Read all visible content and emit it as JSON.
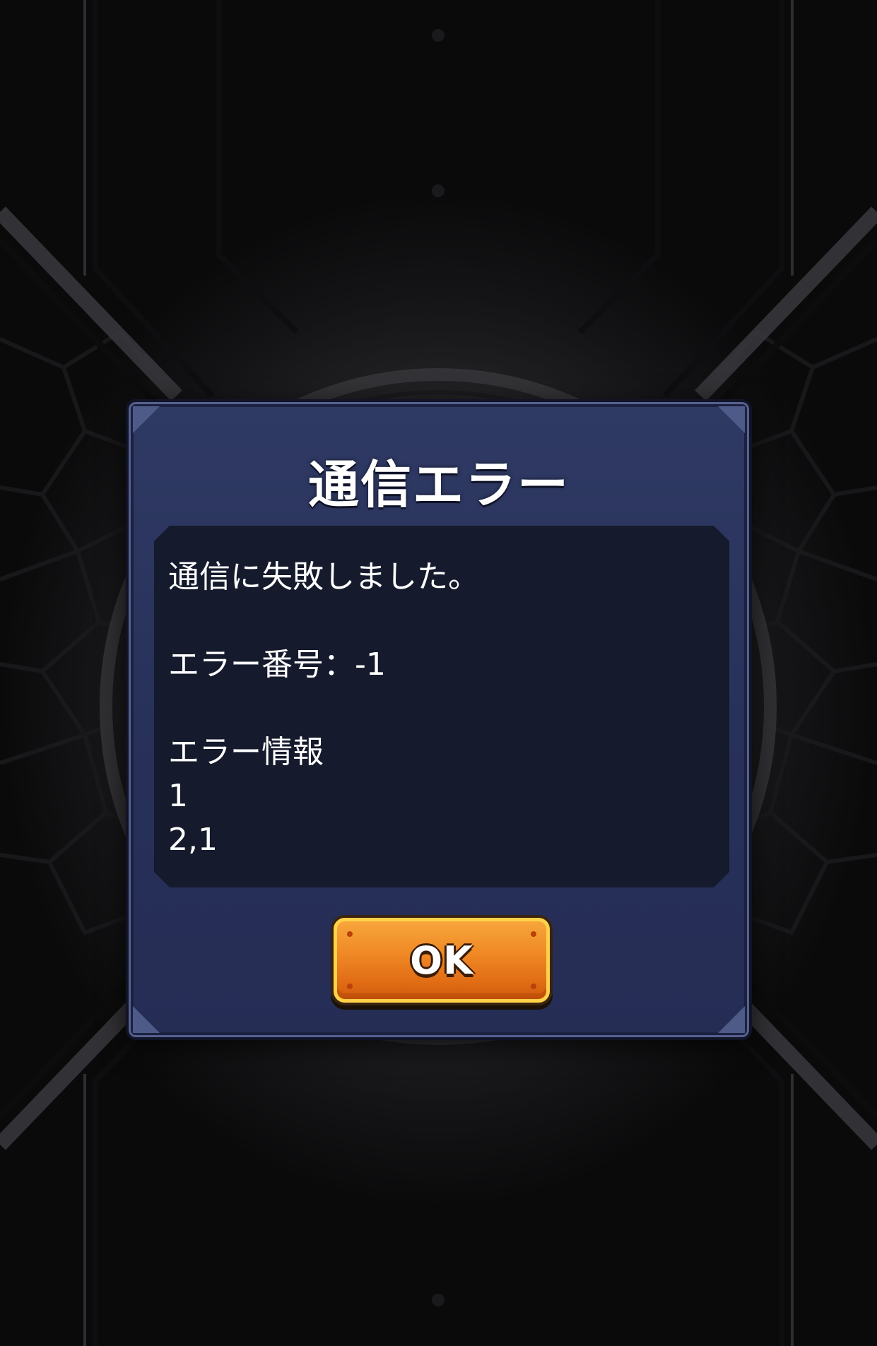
{
  "dialog": {
    "title": "通信エラー",
    "message": {
      "line1": "通信に失敗しました。",
      "error_number": "エラー番号：-1",
      "error_info_label": "エラー情報",
      "error_info_line1": "1",
      "error_info_line2": "2,1"
    },
    "ok_label": "OK"
  },
  "colors": {
    "dialog_bg": "#28315a",
    "dialog_border": "#56618f",
    "message_bg": "#151a2c",
    "button_orange": "#f08a26",
    "button_border": "#ffd24a"
  }
}
